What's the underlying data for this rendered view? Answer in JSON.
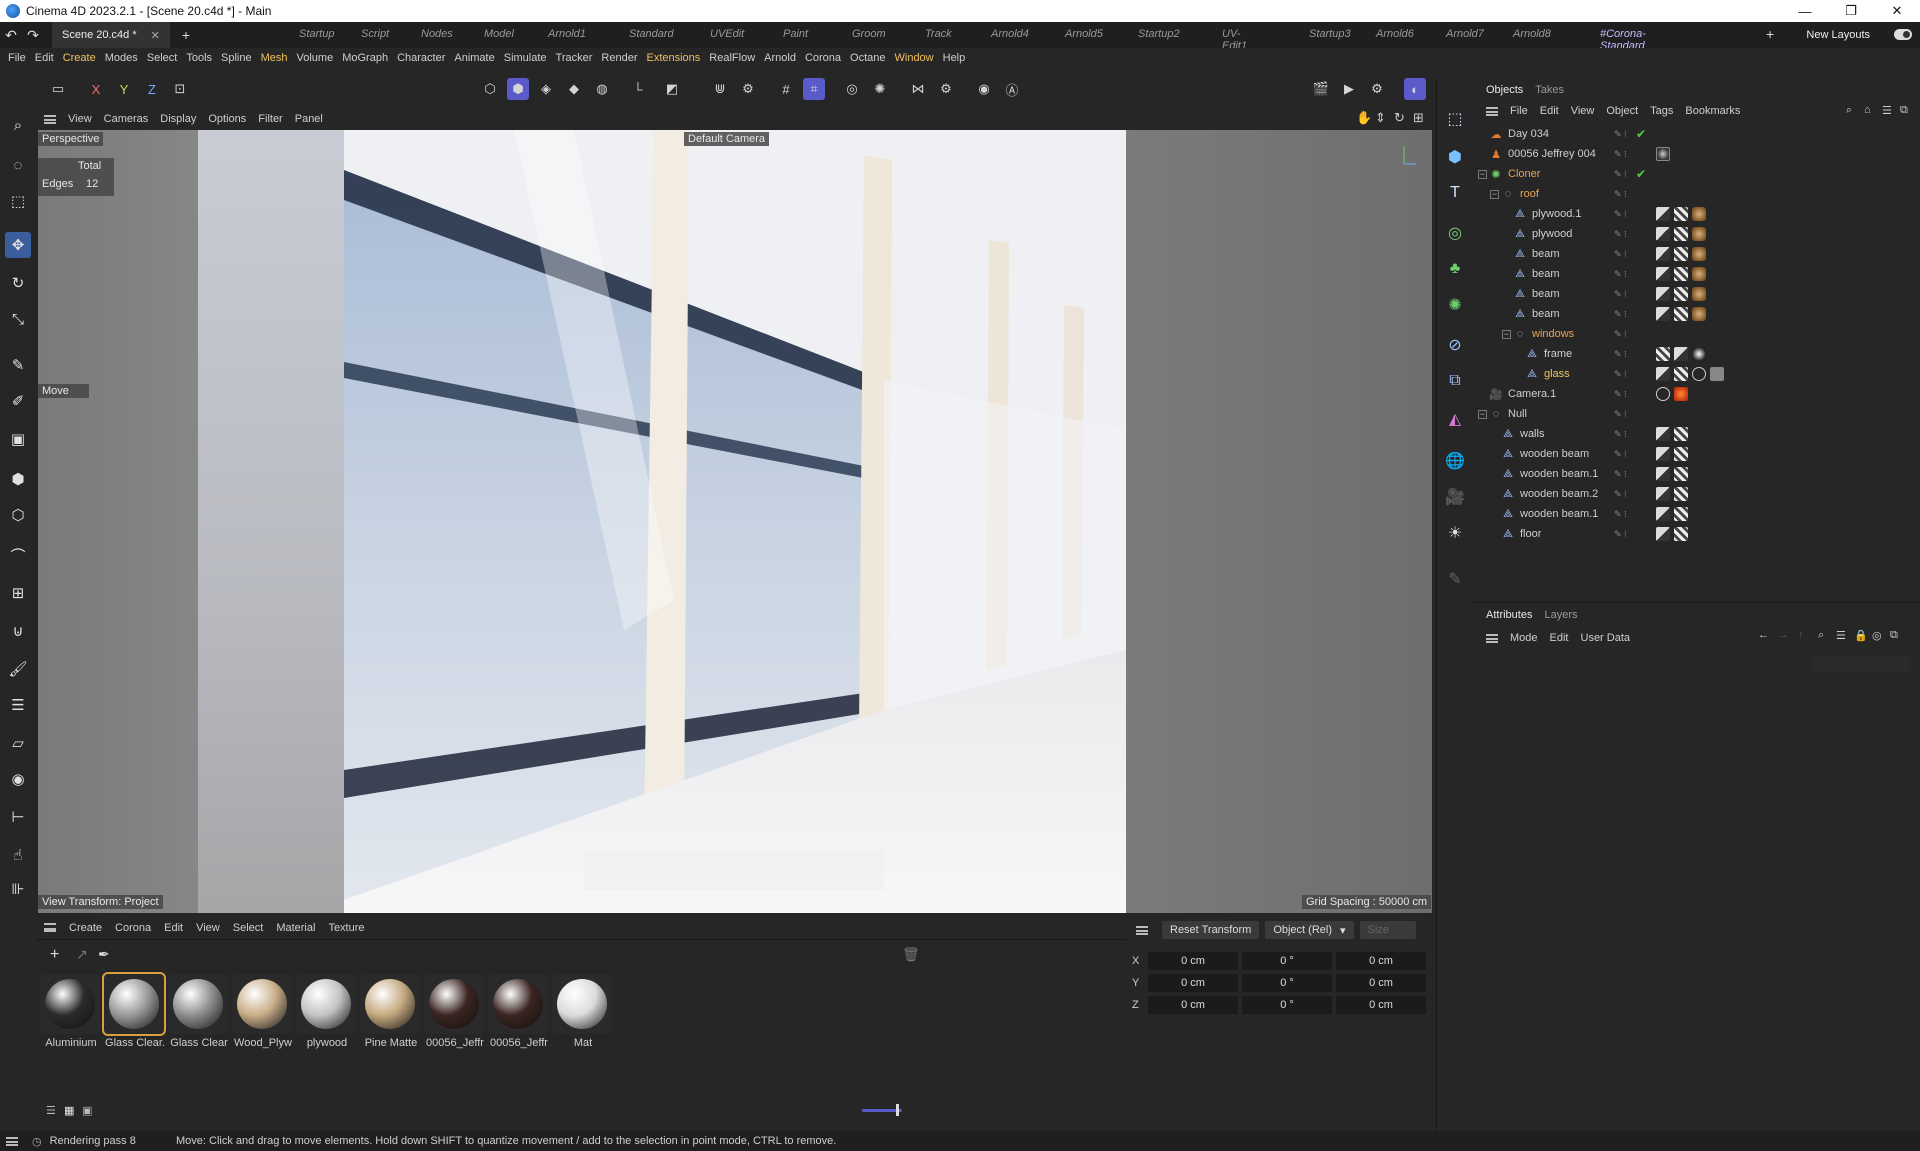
{
  "window": {
    "title": "Cinema 4D 2023.2.1 - [Scene 20.c4d *] - Main",
    "minimize": "—",
    "maximize": "❐",
    "close": "✕"
  },
  "tabs": {
    "document": "Scene 20.c4d *",
    "layouts": [
      "Startup",
      "Script",
      "Nodes",
      "Model",
      "Arnold1",
      "Standard",
      "UVEdit",
      "Paint",
      "Groom",
      "Track",
      "Arnold4",
      "Arnold5",
      "Startup2",
      "UV-Edit1",
      "Startup3",
      "Arnold6",
      "Arnold7",
      "Arnold8",
      "#Corona-Standard"
    ],
    "new_layouts": "New Layouts"
  },
  "menu": [
    "File",
    "Edit",
    "Create",
    "Modes",
    "Select",
    "Tools",
    "Spline",
    "Mesh",
    "Volume",
    "MoGraph",
    "Character",
    "Animate",
    "Simulate",
    "Tracker",
    "Render",
    "Extensions",
    "RealFlow",
    "Arnold",
    "Corona",
    "Octane",
    "Window",
    "Help"
  ],
  "toolbar": {
    "axis_x": "X",
    "axis_y": "Y",
    "axis_z": "Z"
  },
  "viewport": {
    "menu": [
      "View",
      "Cameras",
      "Display",
      "Options",
      "Filter",
      "Panel"
    ],
    "label": "Perspective",
    "camera": "Default Camera",
    "stats_total": "Total",
    "stats_edges_label": "Edges",
    "stats_edges_value": "12",
    "tool": "Move",
    "view_transform": "View Transform: Project",
    "grid_spacing": "Grid Spacing : 50000 cm"
  },
  "materials": {
    "menu": [
      "Create",
      "Corona",
      "Edit",
      "View",
      "Select",
      "Material",
      "Texture"
    ],
    "items": [
      {
        "name": "Aluminium",
        "color": "#2b2b2b"
      },
      {
        "name": "Glass Clear.",
        "color": "#9a9a9a"
      },
      {
        "name": "Glass Clear",
        "color": "#8f8f8f"
      },
      {
        "name": "Wood_Plyw",
        "color": "#c8ae88"
      },
      {
        "name": "plywood",
        "color": "#c4c4c4"
      },
      {
        "name": "Pine Matte",
        "color": "#c6a980"
      },
      {
        "name": "00056_Jeffr",
        "color": "#3a2420"
      },
      {
        "name": "00056_Jeffr",
        "color": "#3a2420"
      },
      {
        "name": "Mat",
        "color": "#dcdcdc"
      }
    ]
  },
  "coordinates": {
    "reset": "Reset Transform",
    "mode": "Object (Rel)",
    "size": "Size",
    "rows": [
      {
        "axis": "X",
        "pos": "0 cm",
        "rot": "0 °",
        "size": "0 cm"
      },
      {
        "axis": "Y",
        "pos": "0 cm",
        "rot": "0 °",
        "size": "0 cm"
      },
      {
        "axis": "Z",
        "pos": "0 cm",
        "rot": "0 °",
        "size": "0 cm"
      }
    ]
  },
  "objects": {
    "tabs": [
      "Objects",
      "Takes"
    ],
    "menu": [
      "File",
      "Edit",
      "View",
      "Object",
      "Tags",
      "Bookmarks"
    ],
    "tree": [
      {
        "name": "Day 034",
        "style": "normal",
        "icon": "sky-icon"
      },
      {
        "name": "00056 Jeffrey 004",
        "style": "normal",
        "icon": "figure-icon"
      },
      {
        "name": "Cloner",
        "style": "orange",
        "icon": "cloner-icon"
      },
      {
        "name": "roof",
        "style": "orange",
        "icon": "null-icon"
      },
      {
        "name": "plywood.1",
        "style": "normal",
        "icon": "poly-icon"
      },
      {
        "name": "plywood",
        "style": "normal",
        "icon": "poly-icon"
      },
      {
        "name": "beam",
        "style": "normal",
        "icon": "poly-icon"
      },
      {
        "name": "beam",
        "style": "normal",
        "icon": "poly-icon"
      },
      {
        "name": "beam",
        "style": "normal",
        "icon": "poly-icon"
      },
      {
        "name": "beam",
        "style": "normal",
        "icon": "poly-icon"
      },
      {
        "name": "windows",
        "style": "orange",
        "icon": "null-icon"
      },
      {
        "name": "frame",
        "style": "normal",
        "icon": "poly-icon"
      },
      {
        "name": "glass",
        "style": "yellow",
        "icon": "poly-icon"
      },
      {
        "name": "Camera.1",
        "style": "normal",
        "icon": "camera-icon"
      },
      {
        "name": "Null",
        "style": "normal",
        "icon": "null-icon"
      },
      {
        "name": "walls",
        "style": "normal",
        "icon": "poly-icon"
      },
      {
        "name": "wooden beam",
        "style": "normal",
        "icon": "poly-icon"
      },
      {
        "name": "wooden beam.1",
        "style": "normal",
        "icon": "poly-icon"
      },
      {
        "name": "wooden beam.2",
        "style": "normal",
        "icon": "poly-icon"
      },
      {
        "name": "wooden beam.1",
        "style": "normal",
        "icon": "poly-icon"
      },
      {
        "name": "floor",
        "style": "normal",
        "icon": "poly-icon"
      }
    ]
  },
  "attributes": {
    "tabs": [
      "Attributes",
      "Layers"
    ],
    "menu": [
      "Mode",
      "Edit",
      "User Data"
    ]
  },
  "status": {
    "render": "Rendering pass 8",
    "hint": "Move: Click and drag to move elements. Hold down SHIFT to quantize movement / add to the selection in point mode, CTRL to remove."
  },
  "colors": {
    "accent": "#5a5acb",
    "selected_layout": "#c9b8ff",
    "orange": "#e8a25a"
  }
}
